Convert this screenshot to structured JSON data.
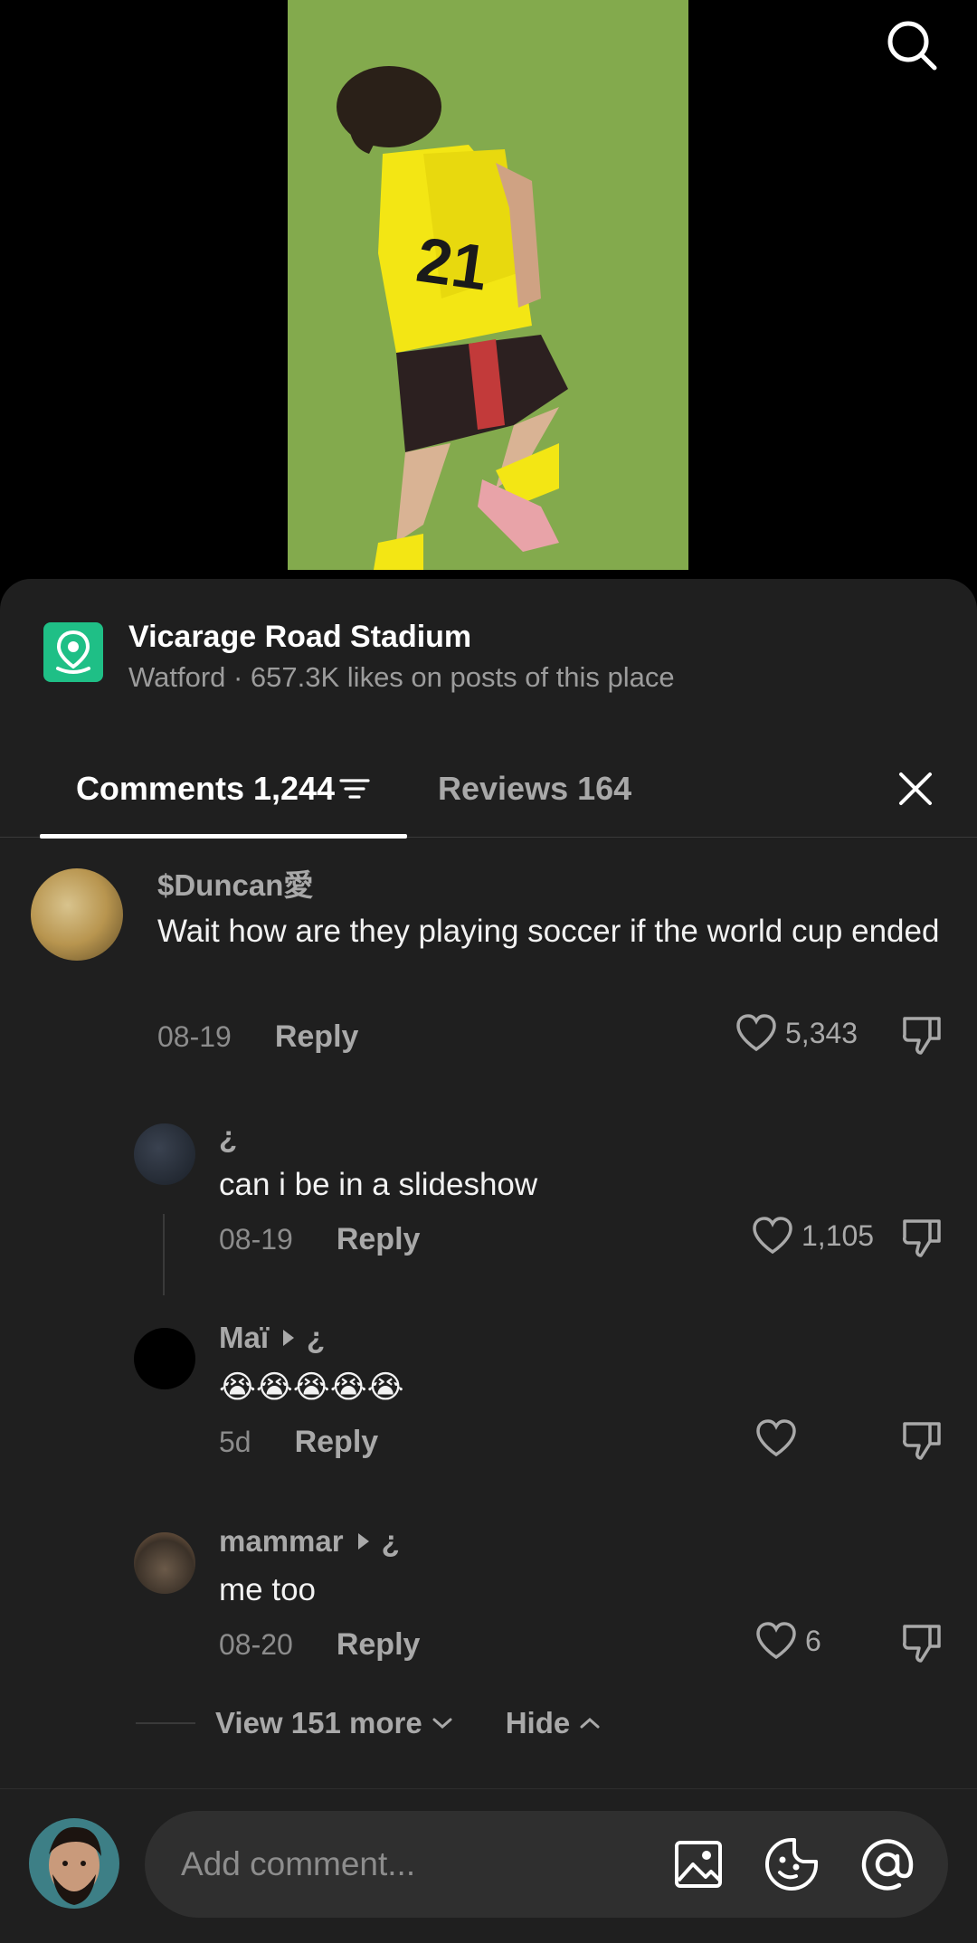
{
  "place": {
    "name": "Vicarage Road Stadium",
    "subtitle": "Watford · 657.3K likes on posts of this place"
  },
  "tabs": {
    "comments_label": "Comments 1,244",
    "reviews_label": "Reviews 164"
  },
  "comments": [
    {
      "username": "$​Duncan愛",
      "text": "Wait how are they playing soccer if the world cup ended",
      "date": "08-19",
      "reply_label": "Reply",
      "likes": "5,343"
    },
    {
      "username": "¿",
      "text": "can i be in a slideshow",
      "date": "08-19",
      "reply_label": "Reply",
      "likes": "1,105"
    },
    {
      "username": "Maï",
      "reply_to": "¿",
      "text": "😭😭😭😭😭",
      "date": "5d",
      "reply_label": "Reply",
      "likes": ""
    },
    {
      "username": "mammar",
      "reply_to": "¿",
      "text": "me too",
      "date": "08-20",
      "reply_label": "Reply",
      "likes": "6"
    }
  ],
  "thread": {
    "view_more_label": "View 151 more",
    "hide_label": "Hide"
  },
  "composer": {
    "placeholder": "Add comment..."
  },
  "colors": {
    "sheet_bg": "#1f1f1f",
    "place_icon_bg": "#1fbf86",
    "muted_text": "#a9a9a9"
  }
}
